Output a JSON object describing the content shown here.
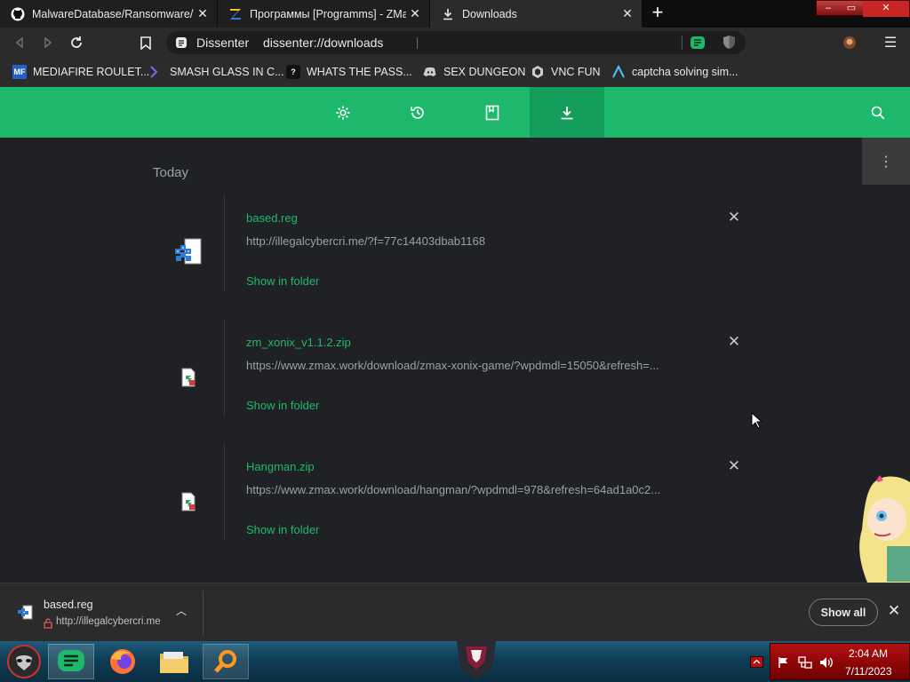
{
  "tabs": [
    {
      "title": "MalwareDatabase/Ransomware/Tr",
      "icon": "github-icon"
    },
    {
      "title": "Программы [Programms] - ZMax",
      "icon": "zmax-icon"
    },
    {
      "title": "Downloads",
      "icon": "download-icon"
    }
  ],
  "window_controls": {
    "minimize": "–",
    "maximize": "▭",
    "close": "✕"
  },
  "omnibox": {
    "site_label": "Dissenter",
    "url": "dissenter://downloads"
  },
  "bookmarks": [
    {
      "label": "MEDIAFIRE ROULET...",
      "icon": "mediafire-icon"
    },
    {
      "label": "SMASH GLASS IN C...",
      "icon": "smash-glass-icon"
    },
    {
      "label": "WHATS THE PASS...",
      "icon": "question-icon"
    },
    {
      "label": "SEX DUNGEON",
      "icon": "discord-icon"
    },
    {
      "label": "VNC FUN",
      "icon": "vnc-icon"
    },
    {
      "label": "captcha solving sim...",
      "icon": "captcha-icon"
    }
  ],
  "downloads_page": {
    "group_label": "Today",
    "items": [
      {
        "name": "based.reg",
        "url": "http://illegalcybercri.me/?f=77c14403dbab1168",
        "action": "Show in folder"
      },
      {
        "name": "zm_xonix_v1.1.2.zip",
        "url": "https://www.zmax.work/download/zmax-xonix-game/?wpdmdl=15050&refresh=...",
        "action": "Show in folder"
      },
      {
        "name": "Hangman.zip",
        "url": "https://www.zmax.work/download/hangman/?wpdmdl=978&refresh=64ad1a0c2...",
        "action": "Show in folder"
      }
    ]
  },
  "shelf": {
    "name": "based.reg",
    "url": "http://illegalcybercri.me",
    "show_all": "Show all"
  },
  "taskbar": {
    "time": "2:04 AM",
    "date": "7/11/2023"
  },
  "colors": {
    "accent": "#1db86c",
    "accent_dark": "#159d5b",
    "background": "#202124"
  }
}
